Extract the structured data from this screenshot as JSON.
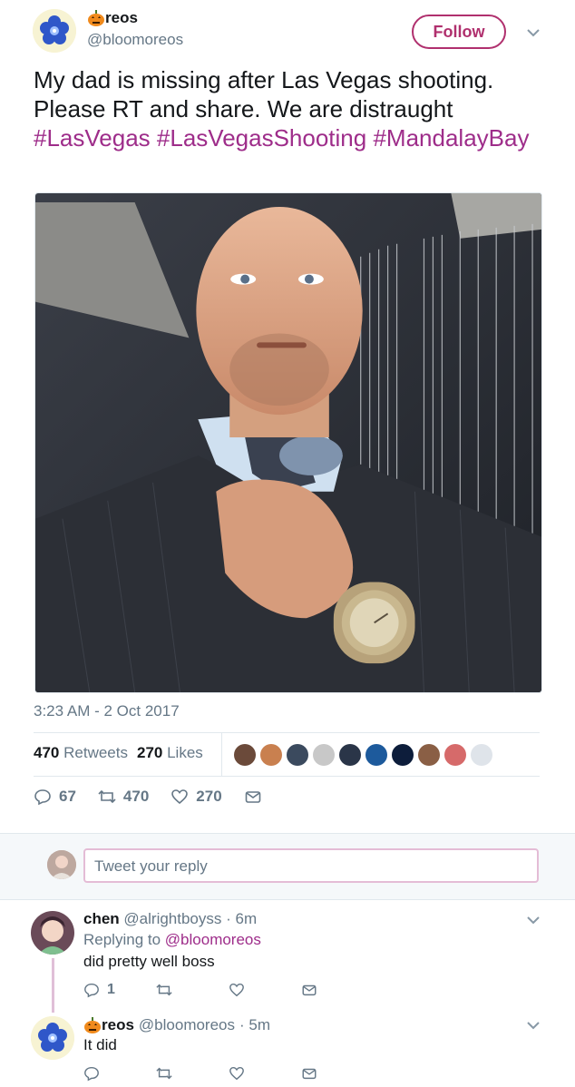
{
  "author": {
    "name_suffix": "reos",
    "handle": "@bloomoreos",
    "follow_label": "Follow"
  },
  "tweet": {
    "text_plain": "My dad is missing after Las Vegas shooting. Please RT and share. We are distraught ",
    "hashtags": [
      "#LasVegas",
      "#LasVegasShooting",
      "#MandalayBay"
    ],
    "timestamp": "3:23 AM - 2 Oct 2017"
  },
  "stats": {
    "retweets_count": "470",
    "retweets_label": "Retweets",
    "likes_count": "270",
    "likes_label": "Likes"
  },
  "actions": {
    "replies": "67",
    "retweets": "470",
    "likes": "270"
  },
  "reply_box": {
    "placeholder": "Tweet your reply"
  },
  "comments": [
    {
      "name": "chen",
      "handle": "@alrightboyss",
      "time": "· 6m",
      "replying_label": "Replying to",
      "replying_to": "@bloomoreos",
      "text": "did pretty well boss",
      "reply_count": "1"
    },
    {
      "name_suffix": "reos",
      "handle": "@bloomoreos",
      "time": "· 5m",
      "text": "It did"
    }
  ],
  "colors": {
    "accent": "#b0306e",
    "hashtag": "#9e2d8a",
    "muted": "#657786"
  }
}
